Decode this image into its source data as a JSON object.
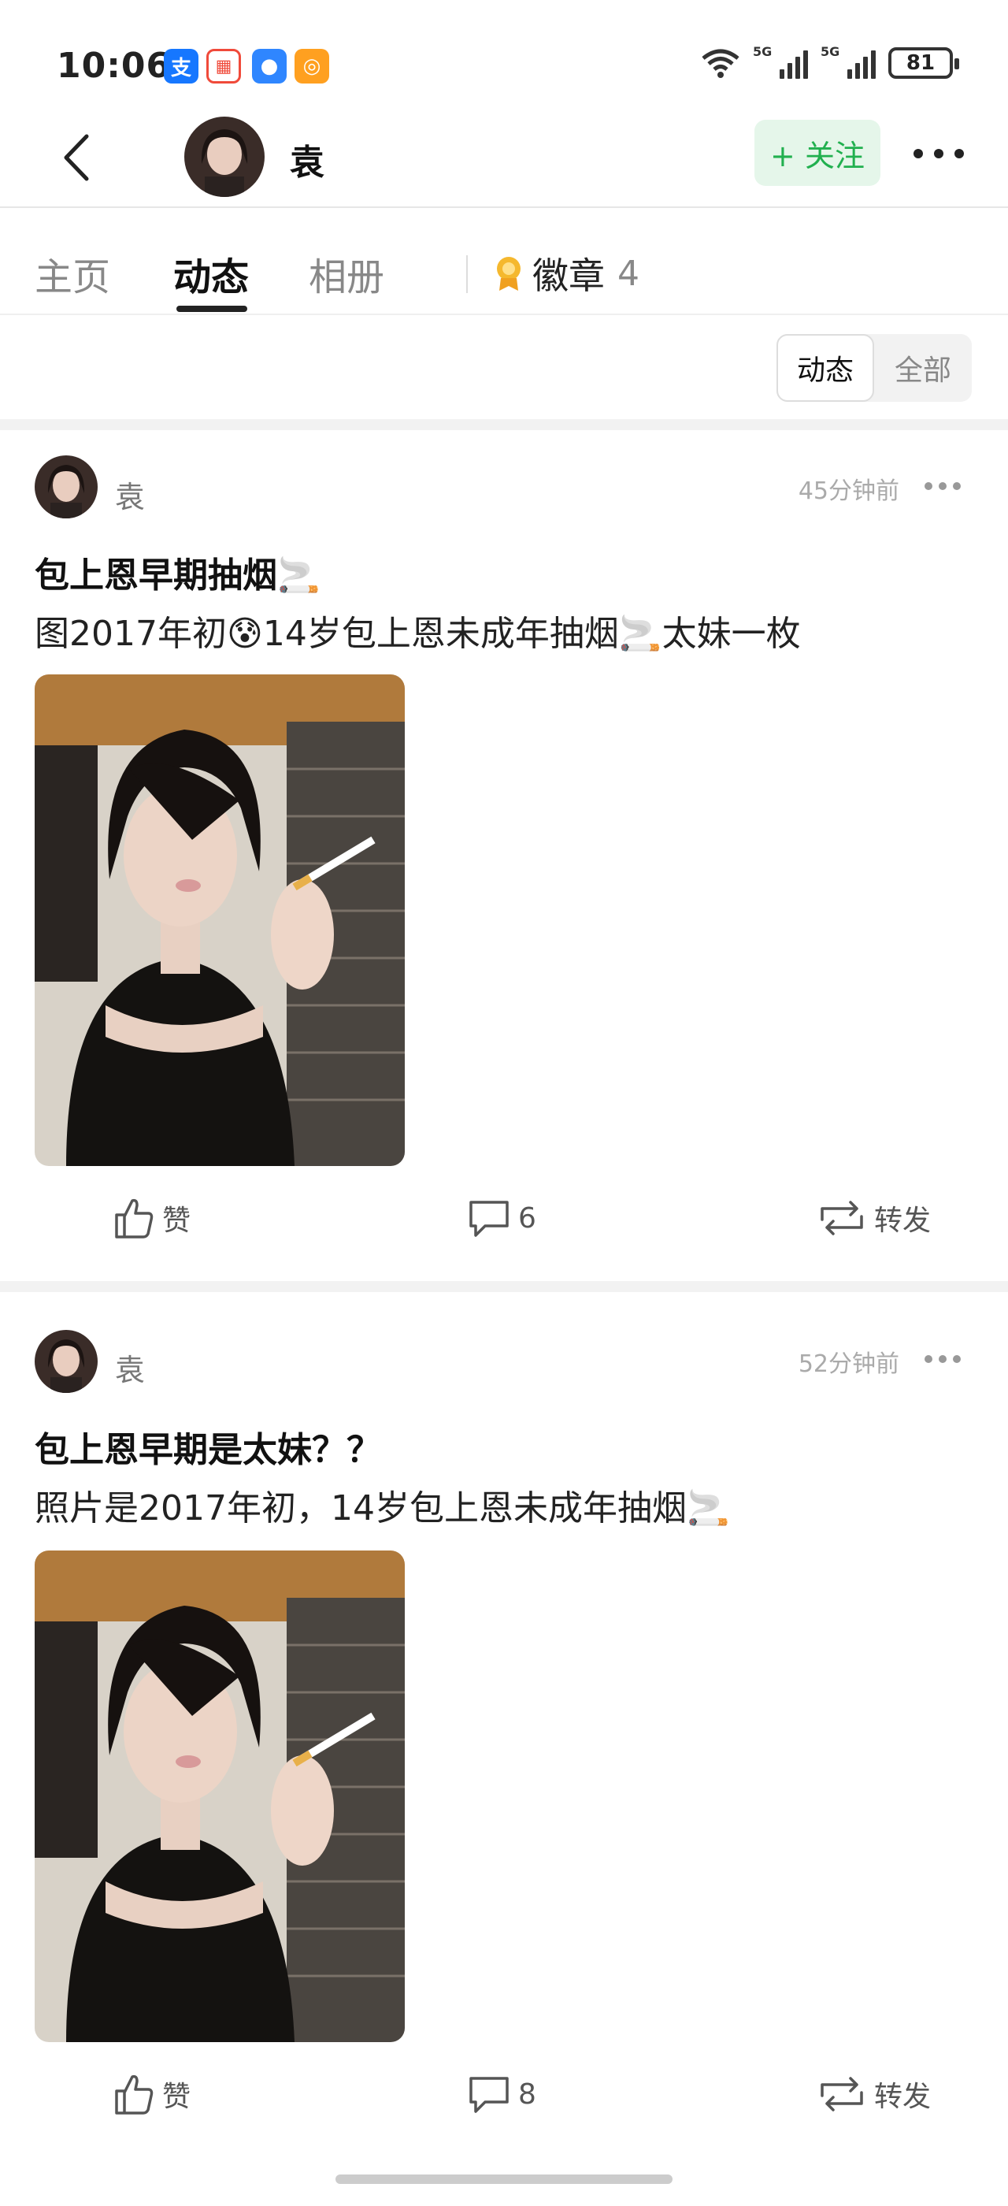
{
  "status_bar": {
    "time": "10:06",
    "battery": "81",
    "network_1": "5G",
    "network_2": "5G"
  },
  "header": {
    "username": "袁",
    "follow_label": "+ 关注"
  },
  "tabs": [
    {
      "label": "主页"
    },
    {
      "label": "动态"
    },
    {
      "label": "相册"
    }
  ],
  "badge_tab": {
    "label": "徽章",
    "count": "4"
  },
  "filter": {
    "option_1": "动态",
    "option_2": "全部"
  },
  "posts": [
    {
      "author": "袁",
      "time": "45分钟前",
      "title": "包上恩早期抽烟🚬",
      "body": "图2017年初😰14岁包上恩未成年抽烟🚬太妹一枚",
      "like_label": "赞",
      "comment_count": "6",
      "repost_label": "转发"
    },
    {
      "author": "袁",
      "time": "52分钟前",
      "title": "包上恩早期是太妹？？",
      "body": "照片是2017年初，14岁包上恩未成年抽烟🚬",
      "like_label": "赞",
      "comment_count": "8",
      "repost_label": "转发"
    }
  ],
  "colors": {
    "accent_green": "#21b04f",
    "follow_bg": "#e5f6ea"
  }
}
